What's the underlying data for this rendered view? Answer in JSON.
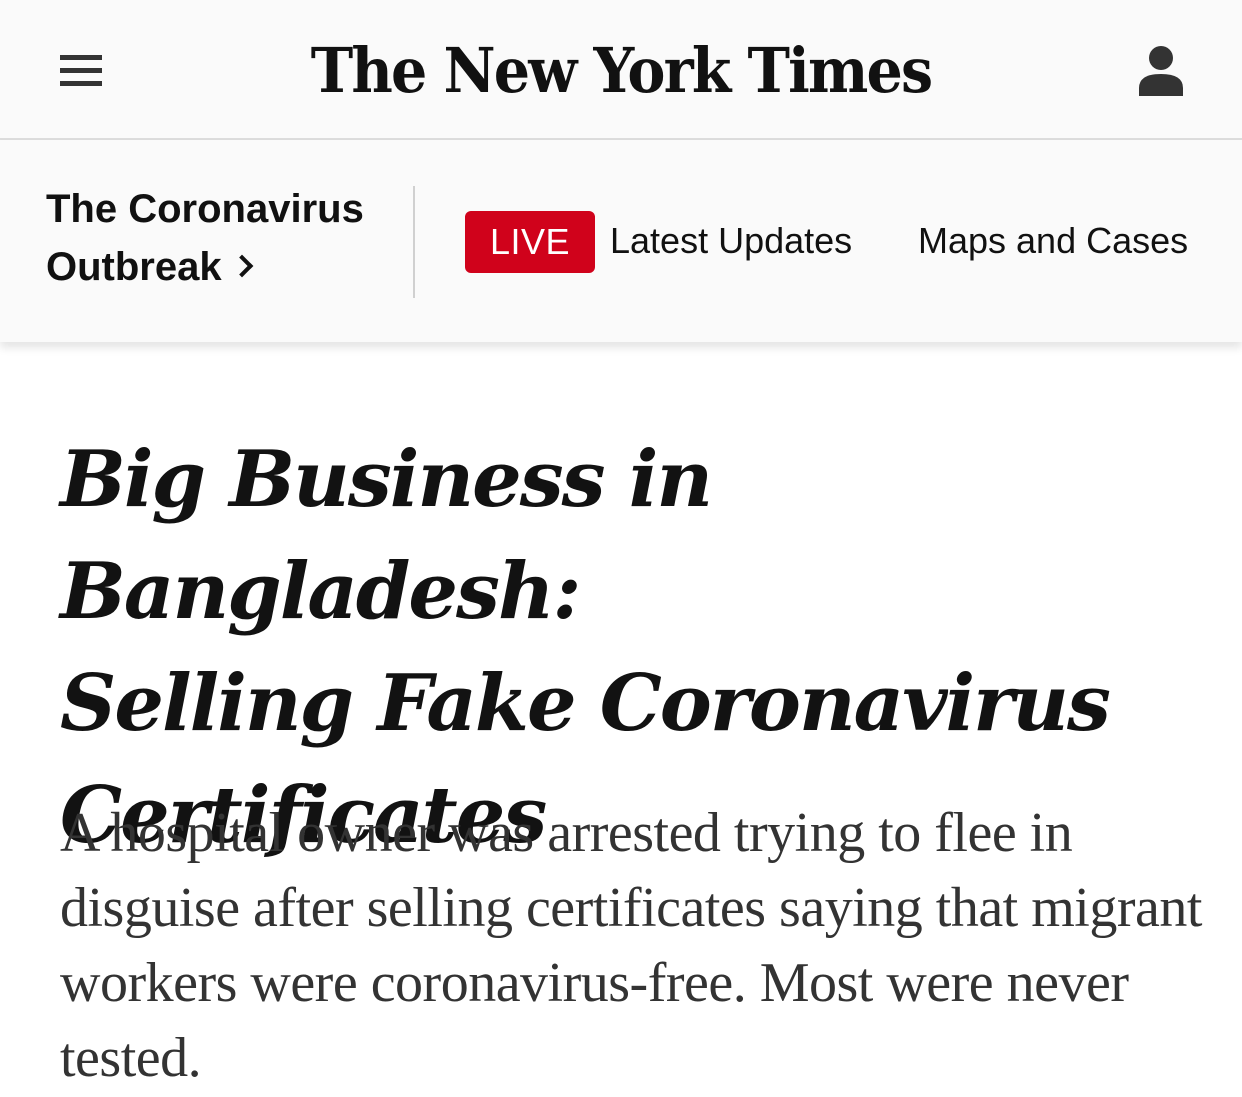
{
  "masthead": {
    "menu_icon": "hamburger-menu-icon",
    "logo_text": "The New York Times",
    "account_icon": "account-user-icon"
  },
  "section_bar": {
    "section_title_line1": "The Coronavirus",
    "section_title_line2": "Outbreak",
    "section_chevron_icon": "chevron-right-icon",
    "live_badge": "LIVE",
    "links": {
      "latest_updates": "Latest Updates",
      "maps_and_cases": "Maps and Cases"
    },
    "live_color": "#d0021b"
  },
  "article": {
    "headline_line1": "Big Business in Bangladesh:",
    "headline_line2": "Selling Fake Coronavirus",
    "headline_line3": "Certificates",
    "summary": "A hospital owner was arrested trying to flee in disguise after selling certificates saying that migrant workers were coronavirus-free. Most were never tested."
  }
}
